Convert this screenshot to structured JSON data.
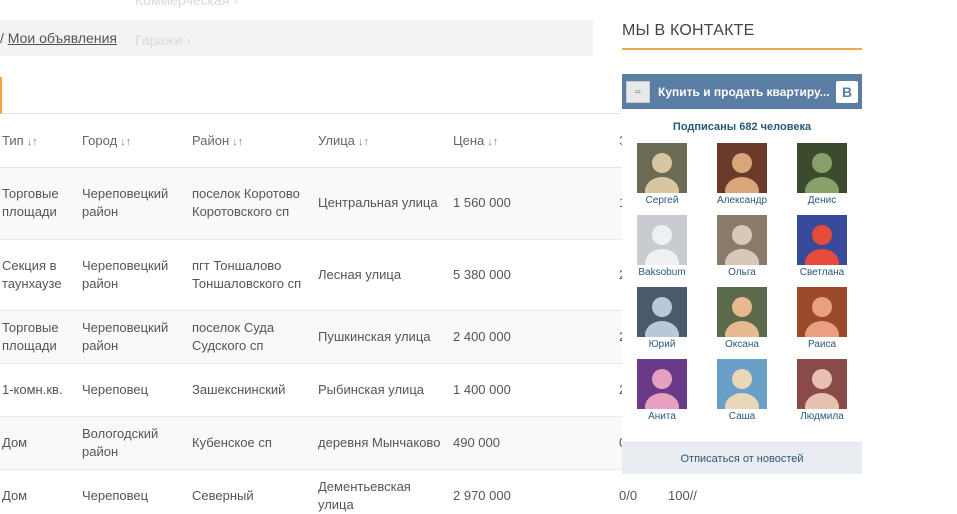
{
  "menu": {
    "ghost_top": "Коммерческая",
    "ghost_mid": "Гаражи"
  },
  "breadcrumb": {
    "separator": "/",
    "link": "Мои объявления"
  },
  "table": {
    "headers": [
      "Тип",
      "Город",
      "Район",
      "Улица",
      "Цена",
      "З"
    ],
    "sort_arrows": "↓↑",
    "rows": [
      {
        "type": "Торговые площади",
        "city": "Череповецкий район",
        "district": "поселок Коротово Коротовского сп",
        "street": "Центральная улица",
        "price": "1 560 000",
        "extra": "1",
        "ratio": "",
        "misc": ""
      },
      {
        "type": "Секция в таунхаузе",
        "city": "Череповецкий район",
        "district": "пгт Тоншалово Тоншаловского сп",
        "street": "Лесная улица",
        "price": "5 380 000",
        "extra": "2",
        "ratio": "",
        "misc": ""
      },
      {
        "type": "Торговые площади",
        "city": "Череповецкий район",
        "district": "поселок Суда Судского сп",
        "street": "Пушкинская улица",
        "price": "2 400 000",
        "extra": "2",
        "ratio": "",
        "misc": ""
      },
      {
        "type": "1-комн.кв.",
        "city": "Череповец",
        "district": "Зашекснинский",
        "street": "Рыбинская улица",
        "price": "1 400 000",
        "extra": "2",
        "ratio": "",
        "misc": ""
      },
      {
        "type": "Дом",
        "city": "Вологодский район",
        "district": "Кубенское сп",
        "street": "деревня Мынчаково",
        "price": "490 000",
        "extra": "0",
        "ratio": "",
        "misc": ""
      },
      {
        "type": "Дом",
        "city": "Череповец",
        "district": "Северный",
        "street": "Дементьевская улица",
        "price": "2 970 000",
        "extra": "0/0",
        "ratio": "100//",
        "misc": ""
      }
    ]
  },
  "vk": {
    "section_title": "МЫ В КОНТАКТЕ",
    "group_name": "Купить и продать квартиру...",
    "vk_logo": "В",
    "subscribers": "Подписаны 682 человека",
    "members": [
      "Сергей",
      "Александр",
      "Денис",
      "Baksobum",
      "Ольга",
      "Светлана",
      "Юрий",
      "Оксана",
      "Раиса",
      "Анита",
      "Саша",
      "Людмила"
    ],
    "unsubscribe": "Отписаться от новостей",
    "colors": {
      "header": "#597da3",
      "accent": "#f2a94b",
      "link": "#2b587a"
    }
  }
}
